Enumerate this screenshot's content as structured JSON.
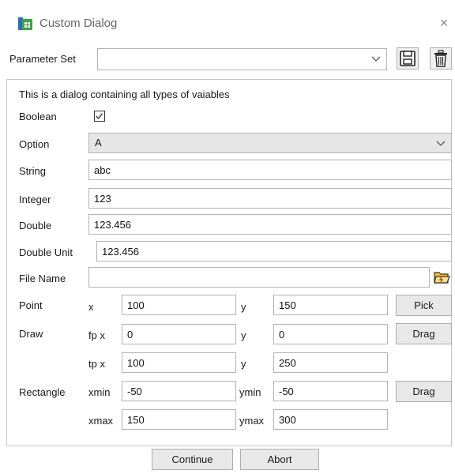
{
  "window": {
    "title": "Custom Dialog",
    "close_glyph": "×"
  },
  "toolbar": {
    "parameter_set_label": "Parameter Set",
    "parameter_set_value": "",
    "save_icon": "floppy-disk-icon",
    "delete_icon": "trash-icon"
  },
  "form": {
    "description": "This is a dialog containing all types of vaiables",
    "boolean": {
      "label": "Boolean",
      "checked": true
    },
    "option": {
      "label": "Option",
      "value": "A"
    },
    "string": {
      "label": "String",
      "value": "abc"
    },
    "integer": {
      "label": "Integer",
      "value": "123"
    },
    "double": {
      "label": "Double",
      "value": "123.456"
    },
    "double_unit": {
      "label": "Double Unit",
      "value": "123.456"
    },
    "file_name": {
      "label": "File Name",
      "value": ""
    },
    "point": {
      "label": "Point",
      "x_label": "x",
      "x": "100",
      "y_label": "y",
      "y": "150",
      "button": "Pick"
    },
    "draw": {
      "label": "Draw",
      "fpx_label": "fp x",
      "fpx": "0",
      "fpy_label": "y",
      "fpy": "0",
      "tpx_label": "tp x",
      "tpx": "100",
      "tpy_label": "y",
      "tpy": "250",
      "button": "Drag"
    },
    "rectangle": {
      "label": "Rectangle",
      "xmin_label": "xmin",
      "xmin": "-50",
      "ymin_label": "ymin",
      "ymin": "-50",
      "xmax_label": "xmax",
      "xmax": "150",
      "ymax_label": "ymax",
      "ymax": "300",
      "button": "Drag"
    }
  },
  "footer": {
    "continue": "Continue",
    "abort": "Abort"
  }
}
